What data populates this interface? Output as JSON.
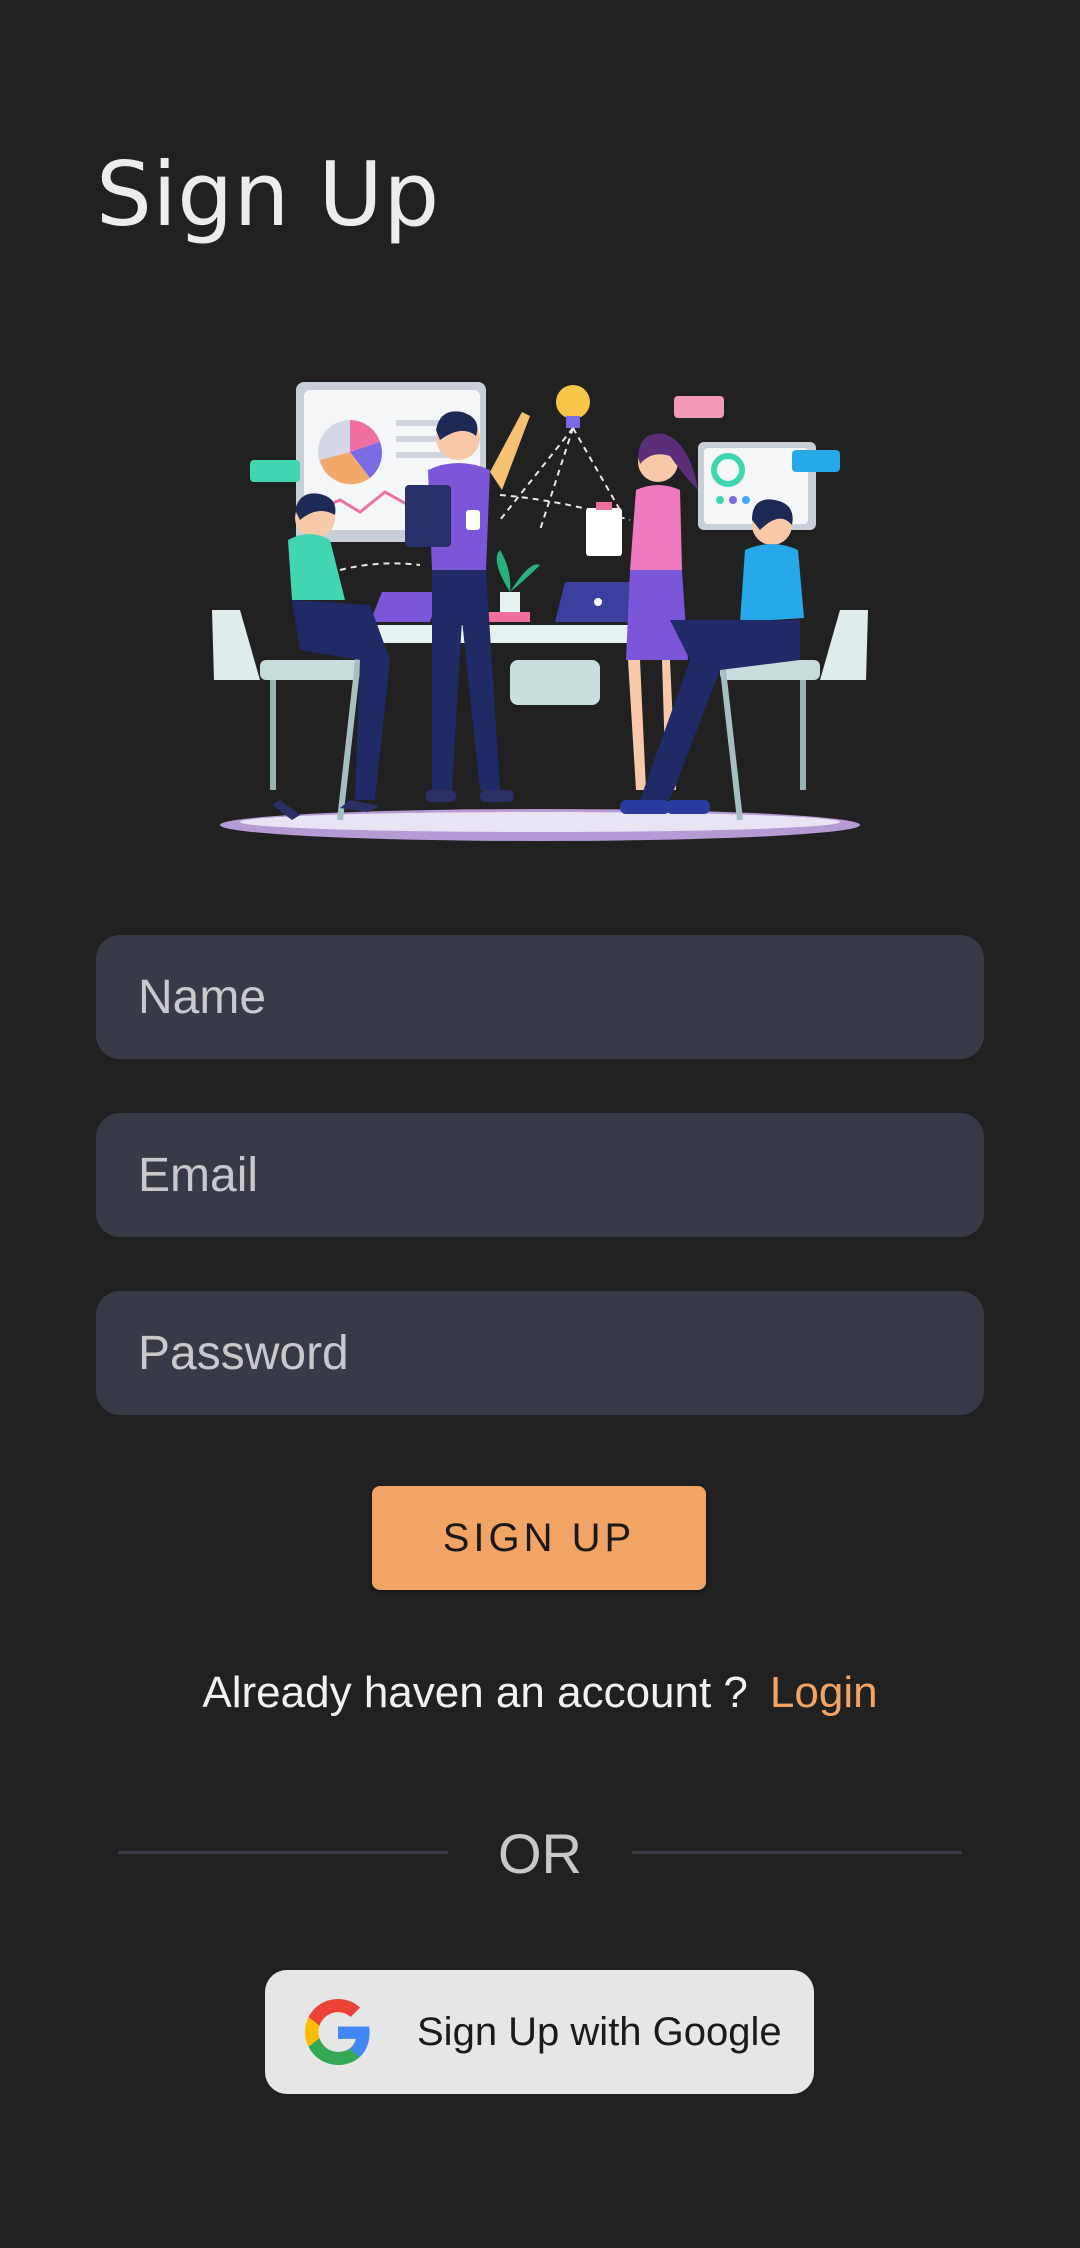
{
  "header": {
    "title": "Sign Up"
  },
  "form": {
    "name_placeholder": "Name",
    "email_placeholder": "Email",
    "password_placeholder": "Password",
    "submit_label": "SIGN UP"
  },
  "login": {
    "prompt": "Already haven an account ?",
    "link_label": "Login"
  },
  "divider": {
    "label": "OR"
  },
  "google": {
    "label": "Sign Up with Google",
    "icon": "google-icon"
  },
  "colors": {
    "background": "#212121",
    "field_background": "#383b45",
    "accent": "#f2a465",
    "google_button": "#e6e6e6"
  }
}
